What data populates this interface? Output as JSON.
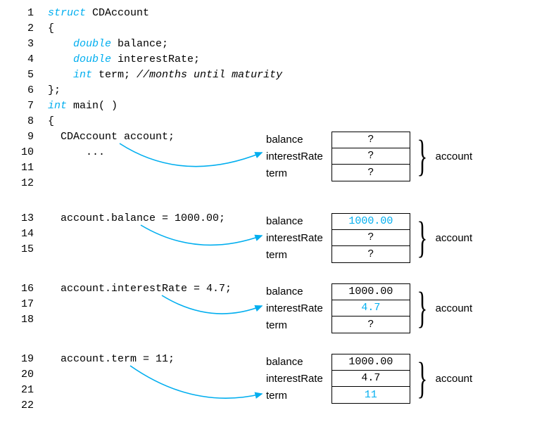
{
  "lines": {
    "l1": {
      "n": "1",
      "kw": "struct",
      "rest": " CDAccount"
    },
    "l2": {
      "n": "2",
      "txt": "{"
    },
    "l3": {
      "n": "3",
      "kw": "double",
      "rest": " balance;"
    },
    "l4": {
      "n": "4",
      "kw": "double",
      "rest": " interestRate;"
    },
    "l5": {
      "n": "5",
      "kw": "int",
      "rest": " term; ",
      "comment": "//months until maturity"
    },
    "l6": {
      "n": "6",
      "txt": "};"
    },
    "l7": {
      "n": "7",
      "kw": "int",
      "rest": " main( )"
    },
    "l8": {
      "n": "8",
      "txt": "{"
    },
    "l9": {
      "n": "9",
      "txt": "  CDAccount account;"
    },
    "l10": {
      "n": "10",
      "txt": "      ..."
    },
    "l11": {
      "n": "11",
      "txt": ""
    },
    "l12": {
      "n": "12",
      "txt": ""
    },
    "l13": {
      "n": "13",
      "txt": "  account.balance = 1000.00;"
    },
    "l14": {
      "n": "14",
      "txt": ""
    },
    "l15": {
      "n": "15",
      "txt": ""
    },
    "l16": {
      "n": "16",
      "txt": "  account.interestRate = 4.7;"
    },
    "l17": {
      "n": "17",
      "txt": ""
    },
    "l18": {
      "n": "18",
      "txt": ""
    },
    "l19": {
      "n": "19",
      "txt": "  account.term = 11;"
    },
    "l20": {
      "n": "20",
      "txt": ""
    },
    "l21": {
      "n": "21",
      "txt": ""
    },
    "l22": {
      "n": "22",
      "txt": ""
    }
  },
  "labels": {
    "balance": "balance",
    "interestRate": "interestRate",
    "term": "term",
    "account": "account"
  },
  "states": {
    "s1": {
      "balance": "?",
      "interestRate": "?",
      "term": "?",
      "hl": []
    },
    "s2": {
      "balance": "1000.00",
      "interestRate": "?",
      "term": "?",
      "hl": [
        "balance"
      ]
    },
    "s3": {
      "balance": "1000.00",
      "interestRate": "4.7",
      "term": "?",
      "hl": [
        "interestRate"
      ]
    },
    "s4": {
      "balance": "1000.00",
      "interestRate": "4.7",
      "term": "11",
      "hl": [
        "term"
      ]
    }
  }
}
